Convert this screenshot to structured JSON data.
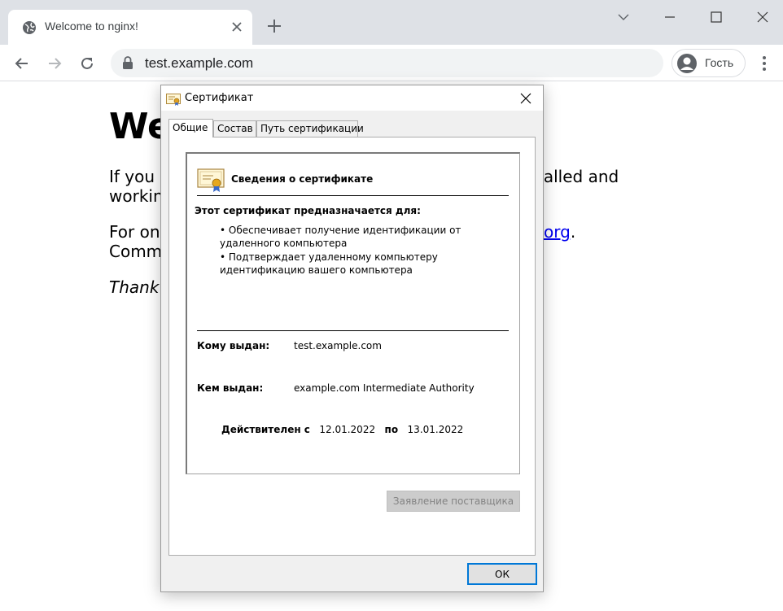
{
  "browser": {
    "tab": {
      "title": "Welcome to nginx!"
    },
    "address": {
      "url": "test.example.com"
    },
    "profile": {
      "label": "Гость"
    }
  },
  "page": {
    "heading": "We",
    "para1_line1_left": "If you s",
    "para1_line1_right": "talled and",
    "para1_line2_left": "working",
    "para2_line1_left": "For onli",
    "para2_link_fragment": "org",
    "para2_period": ".",
    "para2_line2_left": "Comme",
    "para3_left": "Thank y"
  },
  "dialog": {
    "title": "Сертификат",
    "tabs": [
      {
        "label": "Общие",
        "active": true
      },
      {
        "label": "Состав",
        "active": false
      },
      {
        "label": "Путь сертификации",
        "active": false
      }
    ],
    "info_heading": "Сведения о сертификате",
    "purpose_title": "Этот сертификат предназначается для:",
    "purposes": [
      "• Обеспечивает получение идентификации от удаленного компьютера",
      "• Подтверждает удаленному компьютеру идентификацию вашего компьютера"
    ],
    "issued_to_label": "Кому выдан:",
    "issued_to_value": "test.example.com",
    "issued_by_label": "Кем выдан:",
    "issued_by_value": "example.com Intermediate Authority",
    "valid_from_label": "Действителен с",
    "valid_from": "12.01.2022",
    "valid_to_label": "по",
    "valid_to": "13.01.2022",
    "issuer_statement_button": "Заявление поставщика",
    "ok_button": "ОК"
  },
  "colors": {
    "tabstrip": "#dee1e6",
    "omnibox": "#f1f3f4",
    "link": "#0000ee",
    "ok_focus": "#0078d7"
  }
}
